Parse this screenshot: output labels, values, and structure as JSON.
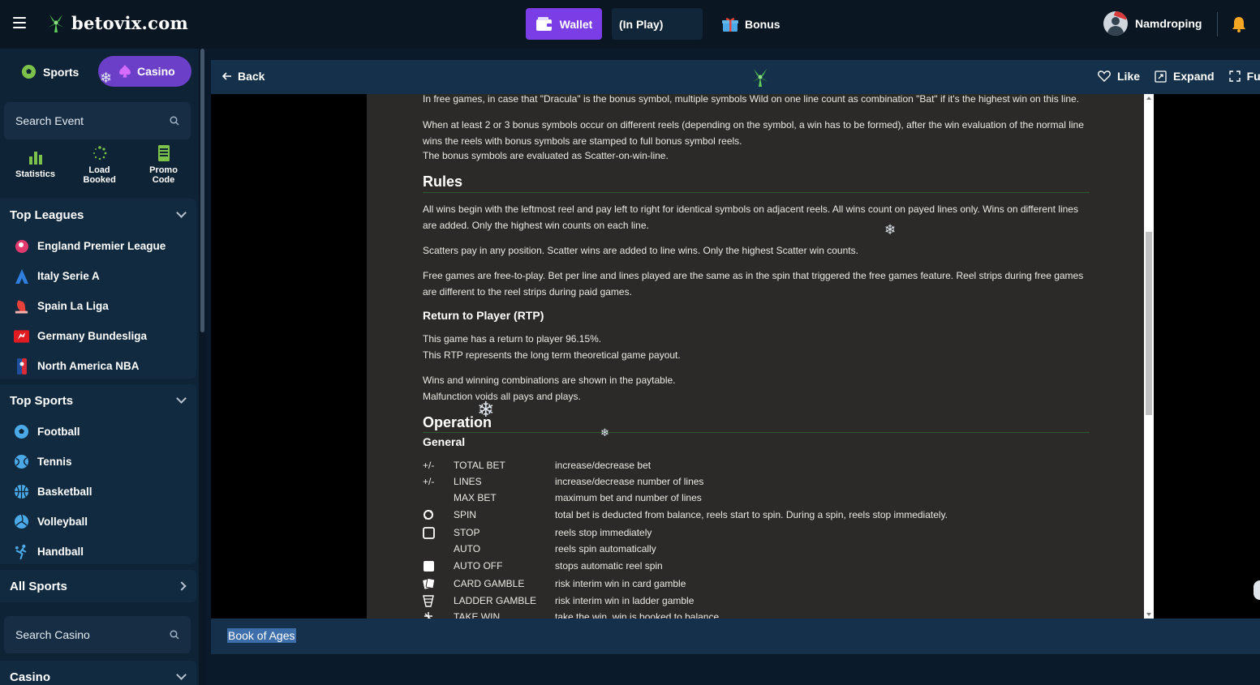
{
  "topbar": {
    "brand": "betovix.com",
    "wallet": "Wallet",
    "in_play": "(In Play)",
    "bonus": "Bonus",
    "username": "Namdroping"
  },
  "sidebar": {
    "toggle": {
      "sports": "Sports",
      "casino": "Casino"
    },
    "search_event": "Search Event",
    "quick_links": [
      {
        "label": "Statistics",
        "icon": "bar-chart-icon"
      },
      {
        "label": "Load Booked",
        "icon": "loading-spinner-icon"
      },
      {
        "label": "Promo Code",
        "icon": "ticket-icon"
      }
    ],
    "top_leagues": {
      "title": "Top Leagues",
      "items": [
        {
          "label": "England Premier League",
          "icon": "premier-league-icon"
        },
        {
          "label": "Italy Serie A",
          "icon": "serie-a-icon"
        },
        {
          "label": "Spain La Liga",
          "icon": "la-liga-icon"
        },
        {
          "label": "Germany Bundesliga",
          "icon": "bundesliga-icon"
        },
        {
          "label": "North America NBA",
          "icon": "nba-icon"
        }
      ]
    },
    "top_sports": {
      "title": "Top Sports",
      "items": [
        {
          "label": "Football",
          "icon": "football-icon"
        },
        {
          "label": "Tennis",
          "icon": "tennis-icon"
        },
        {
          "label": "Basketball",
          "icon": "basketball-icon"
        },
        {
          "label": "Volleyball",
          "icon": "volleyball-icon"
        },
        {
          "label": "Handball",
          "icon": "handball-icon"
        }
      ]
    },
    "all_sports": "All Sports",
    "search_casino": "Search Casino",
    "casino": "Casino"
  },
  "game_header": {
    "back": "Back",
    "like": "Like",
    "expand": "Expand",
    "fullscreen": "Fu"
  },
  "rules_doc": {
    "p_dracula": "In free games, in case that \"Dracula\" is the bonus symbol, multiple symbols Wild on one line count as combination \"Bat\" if it's the highest win on this line.",
    "p_bonus_1": "When at least 2 or 3 bonus symbols occur on different reels (depending on the symbol, a win has to be formed), after the win evaluation of the normal line wins the reels with bonus symbols are stamped to full bonus symbol reels.",
    "p_bonus_2": "The bonus symbols are evaluated as Scatter-on-win-line.",
    "h_rules": "Rules",
    "p_rules_1": "All wins begin with the leftmost reel and pay left to right for identical symbols on adjacent reels. All wins count on payed lines only. Wins on different lines are added. Only the highest win counts on each line.",
    "p_rules_2": "Scatters pay in any position. Scatter wins are added to line wins. Only the highest Scatter win counts.",
    "p_rules_3": "Free games are free-to-play. Bet per line and lines played are the same as in the spin that triggered the free games feature. Reel strips during free games are different to the reel strips during paid games.",
    "h_rtp": "Return to Player (RTP)",
    "p_rtp_1": "This game has a return to player 96.15%.",
    "p_rtp_2": "This RTP represents the long term theoretical game payout.",
    "p_wins_1": "Wins and winning combinations are shown in the paytable.",
    "p_wins_2": "Malfunction voids all pays and plays.",
    "h_operation": "Operation",
    "h_general": "General",
    "operations": [
      {
        "symbol": "+/-",
        "key": "TOTAL BET",
        "desc": "increase/decrease bet"
      },
      {
        "symbol": "+/-",
        "key": "LINES",
        "desc": "increase/decrease number of lines"
      },
      {
        "symbol": "",
        "key": "MAX BET",
        "desc": "maximum bet and number of lines"
      },
      {
        "symbol": "spin-icon",
        "key": "SPIN",
        "desc": "total bet is deducted from balance, reels start to spin. During a spin, reels stop immediately."
      },
      {
        "symbol": "stop-square-icon",
        "key": "STOP",
        "desc": "reels stop immediately"
      },
      {
        "symbol": "",
        "key": "AUTO",
        "desc": "reels spin automatically"
      },
      {
        "symbol": "filled-square-icon",
        "key": "AUTO OFF",
        "desc": "stops automatic reel spin"
      },
      {
        "symbol": "card-icon",
        "key": "CARD GAMBLE",
        "desc": "risk interim win in card gamble"
      },
      {
        "symbol": "ladder-icon",
        "key": "LADDER GAMBLE",
        "desc": "risk interim win in ladder gamble"
      },
      {
        "symbol": "take-win-icon",
        "key": "TAKE WIN",
        "desc": "take the win, win is booked to balance"
      }
    ]
  },
  "game_title": "Book of Ages",
  "colors": {
    "topbar_bg": "#0a1622",
    "sidebar_bg": "#0f2336",
    "wallet_purple": "#7b3ee6",
    "casino_purple": "#6c3fc9",
    "doc_bg": "#2b2a28",
    "bell_orange": "#f5a623"
  }
}
